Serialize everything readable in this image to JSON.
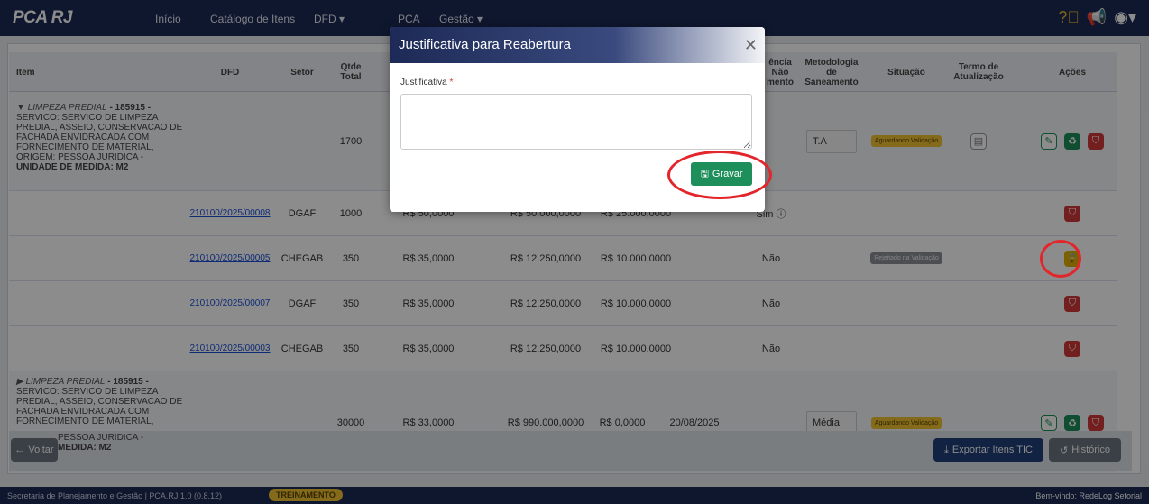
{
  "navbar": {
    "brand": "PCA RJ",
    "items": [
      "Início",
      "Catálogo de Itens",
      "DFD ▾",
      "PCA",
      "Gestão ▾"
    ],
    "icons": [
      "help-icon",
      "megaphone-icon",
      "user-icon"
    ]
  },
  "table": {
    "headers": {
      "item": "Item",
      "dfd": "DFD",
      "setor": "Setor",
      "qtde": "Qtde Total",
      "pendencia": "ência Não mento",
      "metodologia": "Metodologia de Saneamento",
      "situacao": "Situação",
      "termo": "Termo de Atualização",
      "acoes": "Ações"
    },
    "group1": {
      "category": "▼ LIMPEZA PREDIAL",
      "code": " - 185915 -",
      "description": "SERVICO: SERVICO DE LIMPEZA PREDIAL, ASSEIO, CONSERVACAO DE FACHADA ENVIDRACADA COM FORNECIMENTO DE MATERIAL, ORIGEM: PESSOA JURIDICA -",
      "unit": "Unidade de Medida: M2",
      "qtde": "1700",
      "metodologia": "T.A",
      "situacao": "Aguardando Validação"
    },
    "rows": [
      {
        "dfd": "210100/2025/00008",
        "setor": "DGAF",
        "qtde": "1000",
        "unit": "R$ 50,0000",
        "total": "R$ 50.000,0000",
        "saldo": "R$ 25.000,0000",
        "pend": "Sim ⓘ",
        "situacao": ""
      },
      {
        "dfd": "210100/2025/00005",
        "setor": "CHEGAB",
        "qtde": "350",
        "unit": "R$ 35,0000",
        "total": "R$ 12.250,0000",
        "saldo": "R$ 10.000,0000",
        "pend": "Não",
        "situacao": "Rejeitado na Validação"
      },
      {
        "dfd": "210100/2025/00007",
        "setor": "DGAF",
        "qtde": "350",
        "unit": "R$ 35,0000",
        "total": "R$ 12.250,0000",
        "saldo": "R$ 10.000,0000",
        "pend": "Não",
        "situacao": ""
      },
      {
        "dfd": "210100/2025/00003",
        "setor": "CHEGAB",
        "qtde": "350",
        "unit": "R$ 35,0000",
        "total": "R$ 12.250,0000",
        "saldo": "R$ 10.000,0000",
        "pend": "Não",
        "situacao": ""
      }
    ],
    "group2": {
      "category": "▶ LIMPEZA PREDIAL",
      "code": " - 185915 -",
      "description": "SERVICO: SERVICO DE LIMPEZA PREDIAL, ASSEIO, CONSERVACAO DE FACHADA ENVIDRACADA COM FORNECIMENTO DE MATERIAL,",
      "desc_tail": "PESSOA JURIDICA -",
      "unit_tail": "Medida: M2",
      "qtde": "30000",
      "unit": "R$ 33,0000",
      "total": "R$ 990.000,0000",
      "saldo": "R$ 0,0000",
      "date": "20/08/2025",
      "metodologia": "Média",
      "situacao": "Aguardando Validação"
    }
  },
  "bottom": {
    "voltar": "Voltar",
    "exportar": "Exportar Itens TIC",
    "historico": "Histórico"
  },
  "footer": {
    "left": "Secretaria de Planejamento e Gestão | PCA.RJ 1.0 (0.8.12)",
    "badge": "TREINAMENTO",
    "right": "Bem-vindo: RedeLog Setorial"
  },
  "modal": {
    "title": "Justificativa para Reabertura",
    "label": "Justificativa",
    "required_mark": "*",
    "textarea_value": "",
    "save_label": "Gravar"
  },
  "colors": {
    "navbar": "#1d2a57",
    "primary_green": "#1e8f5b",
    "danger": "#d23a3a",
    "warning": "#f1c232",
    "highlight_ring": "#e3262b"
  }
}
